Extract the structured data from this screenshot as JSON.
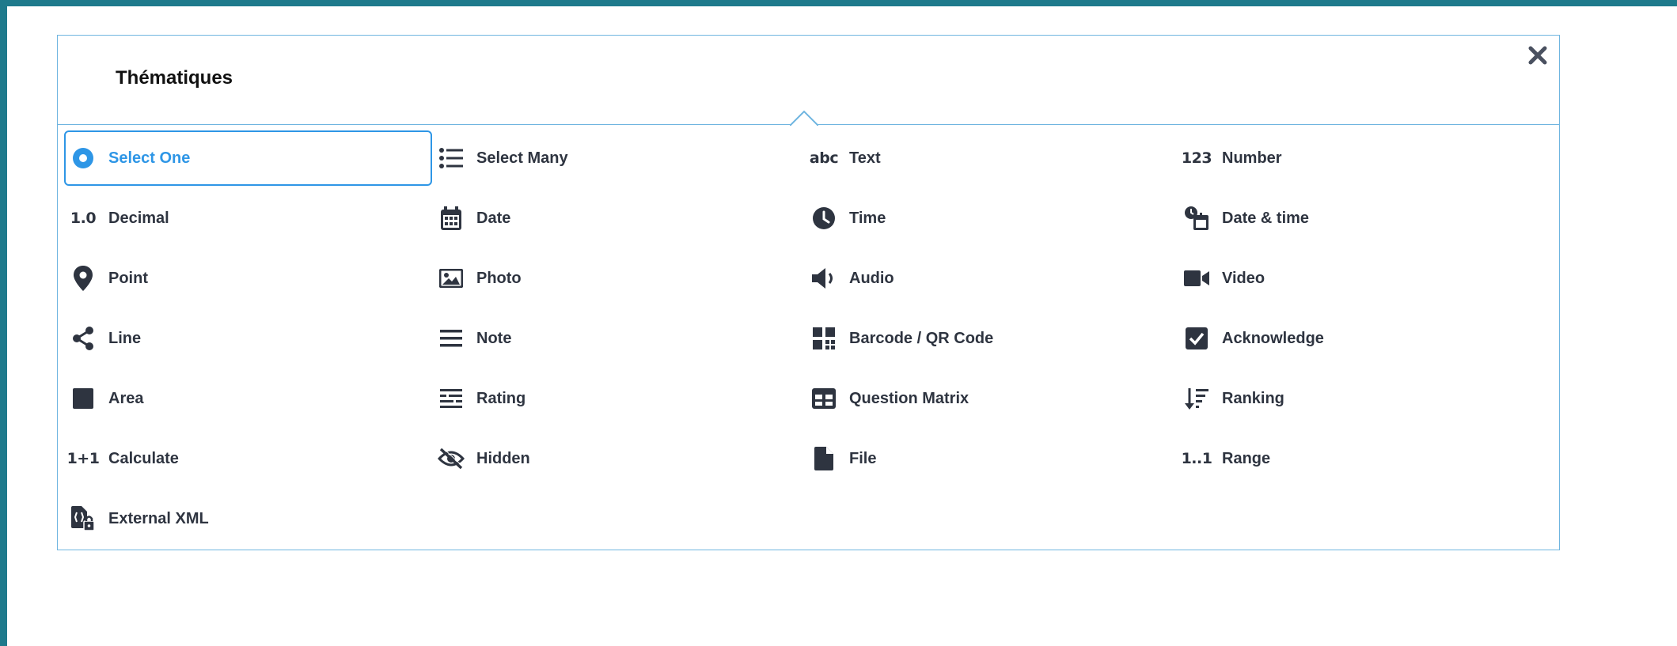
{
  "panel": {
    "title": "Thématiques"
  },
  "colors": {
    "accent": "#2e96e6",
    "frame": "#1f7a8c",
    "border": "#6fb5e0",
    "text": "#2e3440"
  },
  "items": [
    {
      "label": "Select One",
      "icon": "radio-selected-icon",
      "selected": true
    },
    {
      "label": "Select Many",
      "icon": "list-icon"
    },
    {
      "label": "Text",
      "icon": "text-abc-icon",
      "glyph": "abc"
    },
    {
      "label": "Number",
      "icon": "number-icon",
      "glyph": "123"
    },
    {
      "label": "Decimal",
      "icon": "decimal-icon",
      "glyph": "1.0"
    },
    {
      "label": "Date",
      "icon": "calendar-icon"
    },
    {
      "label": "Time",
      "icon": "clock-icon"
    },
    {
      "label": "Date & time",
      "icon": "date-time-icon"
    },
    {
      "label": "Point",
      "icon": "map-pin-icon"
    },
    {
      "label": "Photo",
      "icon": "photo-icon"
    },
    {
      "label": "Audio",
      "icon": "audio-icon"
    },
    {
      "label": "Video",
      "icon": "video-icon"
    },
    {
      "label": "Line",
      "icon": "share-line-icon"
    },
    {
      "label": "Note",
      "icon": "note-lines-icon"
    },
    {
      "label": "Barcode / QR Code",
      "icon": "qr-code-icon"
    },
    {
      "label": "Acknowledge",
      "icon": "checkbox-icon"
    },
    {
      "label": "Area",
      "icon": "area-square-icon"
    },
    {
      "label": "Rating",
      "icon": "rating-icon"
    },
    {
      "label": "Question Matrix",
      "icon": "matrix-icon"
    },
    {
      "label": "Ranking",
      "icon": "ranking-icon"
    },
    {
      "label": "Calculate",
      "icon": "calculate-icon",
      "glyph": "1+1"
    },
    {
      "label": "Hidden",
      "icon": "eye-slash-icon"
    },
    {
      "label": "File",
      "icon": "file-icon"
    },
    {
      "label": "Range",
      "icon": "range-icon",
      "glyph": "1..1"
    },
    {
      "label": "External XML",
      "icon": "external-xml-icon"
    }
  ]
}
